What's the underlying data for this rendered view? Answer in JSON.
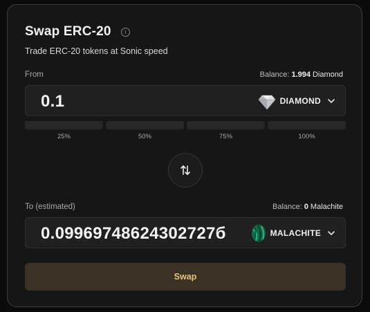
{
  "header": {
    "title": "Swap ERC-20",
    "info_icon": "info-icon",
    "subtitle": "Trade ERC-20 tokens at Sonic speed"
  },
  "from": {
    "label": "From",
    "balance_label": "Balance:",
    "balance_value": "1.994",
    "balance_symbol": "Diamond",
    "amount": "0.1",
    "token_name": "DIAMOND",
    "token_icon": "diamond-gem-icon"
  },
  "percent_buttons": [
    {
      "label": "25%"
    },
    {
      "label": "50%"
    },
    {
      "label": "75%"
    },
    {
      "label": "100%"
    }
  ],
  "switch_icon": "swap-arrows-icon",
  "to": {
    "label": "To (estimated)",
    "balance_label": "Balance:",
    "balance_value": "0",
    "balance_symbol": "Malachite",
    "amount": "0.09969748624302727б",
    "token_name": "MALACHITE",
    "token_icon": "malachite-stone-icon"
  },
  "action": {
    "swap_label": "Swap"
  },
  "colors": {
    "background": "#0b0b0b",
    "card": "#161616",
    "input": "#202020",
    "swap_button_bg": "#3a3224",
    "swap_button_text": "#e8c27a"
  }
}
